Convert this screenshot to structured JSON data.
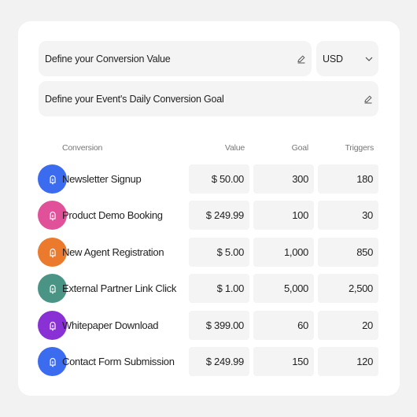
{
  "form": {
    "conversion_value_label": "Define your Conversion Value",
    "currency": "USD",
    "daily_goal_label": "Define your Event's Daily Conversion Goal"
  },
  "table": {
    "headers": {
      "conversion": "Conversion",
      "value": "Value",
      "goal": "Goal",
      "triggers": "Triggers"
    },
    "rows": [
      {
        "name": "Newsletter Signup",
        "value": "$ 50.00",
        "goal": "300",
        "triggers": "180",
        "color": "#3b6cf0"
      },
      {
        "name": "Product Demo Booking",
        "value": "$ 249.99",
        "goal": "100",
        "triggers": "30",
        "color": "#e0519a"
      },
      {
        "name": "New Agent Registration",
        "value": "$ 5.00",
        "goal": "1,000",
        "triggers": "850",
        "color": "#ec7a2c"
      },
      {
        "name": "External Partner Link Click",
        "value": "$ 1.00",
        "goal": "5,000",
        "triggers": "2,500",
        "color": "#4a9486"
      },
      {
        "name": "Whitepaper Download",
        "value": "$ 399.00",
        "goal": "60",
        "triggers": "20",
        "color": "#8a31d6"
      },
      {
        "name": "Contact Form Submission",
        "value": "$ 249.99",
        "goal": "150",
        "triggers": "120",
        "color": "#3b6cf0"
      }
    ]
  },
  "icons": {
    "edit": "pencil-icon",
    "dropdown": "chevron-down-icon",
    "conversion": "bell-icon"
  }
}
